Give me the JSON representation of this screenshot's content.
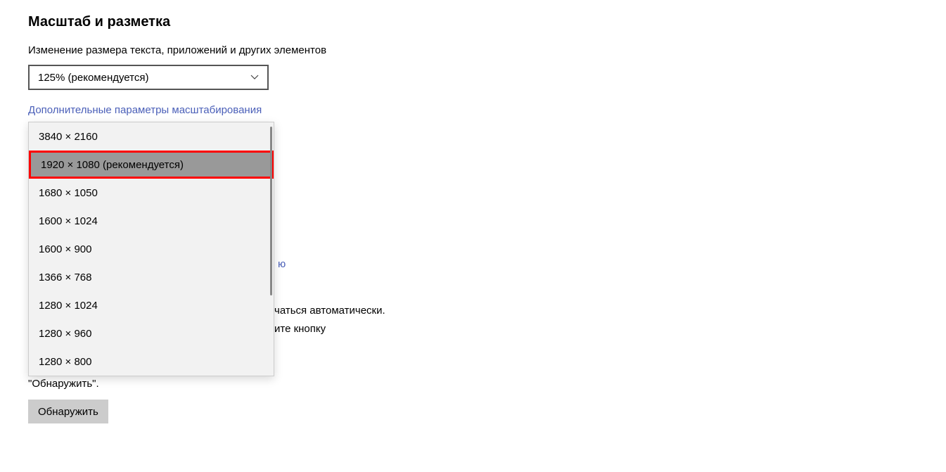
{
  "section": {
    "title": "Масштаб и разметка"
  },
  "scale": {
    "label": "Изменение размера текста, приложений и других элементов",
    "selected": "125% (рекомендуется)"
  },
  "advanced_link": "Дополнительные параметры масштабирования",
  "resolution": {
    "options": [
      "3840 × 2160",
      "1920 × 1080 (рекомендуется)",
      "1680 × 1050",
      "1600 × 1024",
      "1600 × 900",
      "1366 × 768",
      "1280 × 1024",
      "1280 × 960",
      "1280 × 800"
    ],
    "highlighted_index": 1
  },
  "partial_text": {
    "link_fragment": "ю",
    "line1_fragment": "чаться автоматически.",
    "line2_fragment": "ите кнопку",
    "line3": "\"Обнаружить\"."
  },
  "detect_button": "Обнаружить"
}
